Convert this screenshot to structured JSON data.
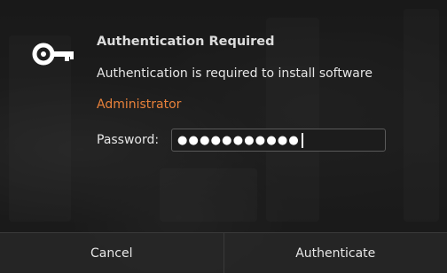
{
  "dialog": {
    "title": "Authentication Required",
    "message": "Authentication is required to install software",
    "user": "Administrator",
    "password_label": "Password:",
    "password_masked": "●●●●●●●●●●●",
    "icon": "key-icon"
  },
  "buttons": {
    "cancel": "Cancel",
    "authenticate": "Authenticate"
  },
  "colors": {
    "user_accent": "#e8813a",
    "text": "#e6e6e6"
  }
}
